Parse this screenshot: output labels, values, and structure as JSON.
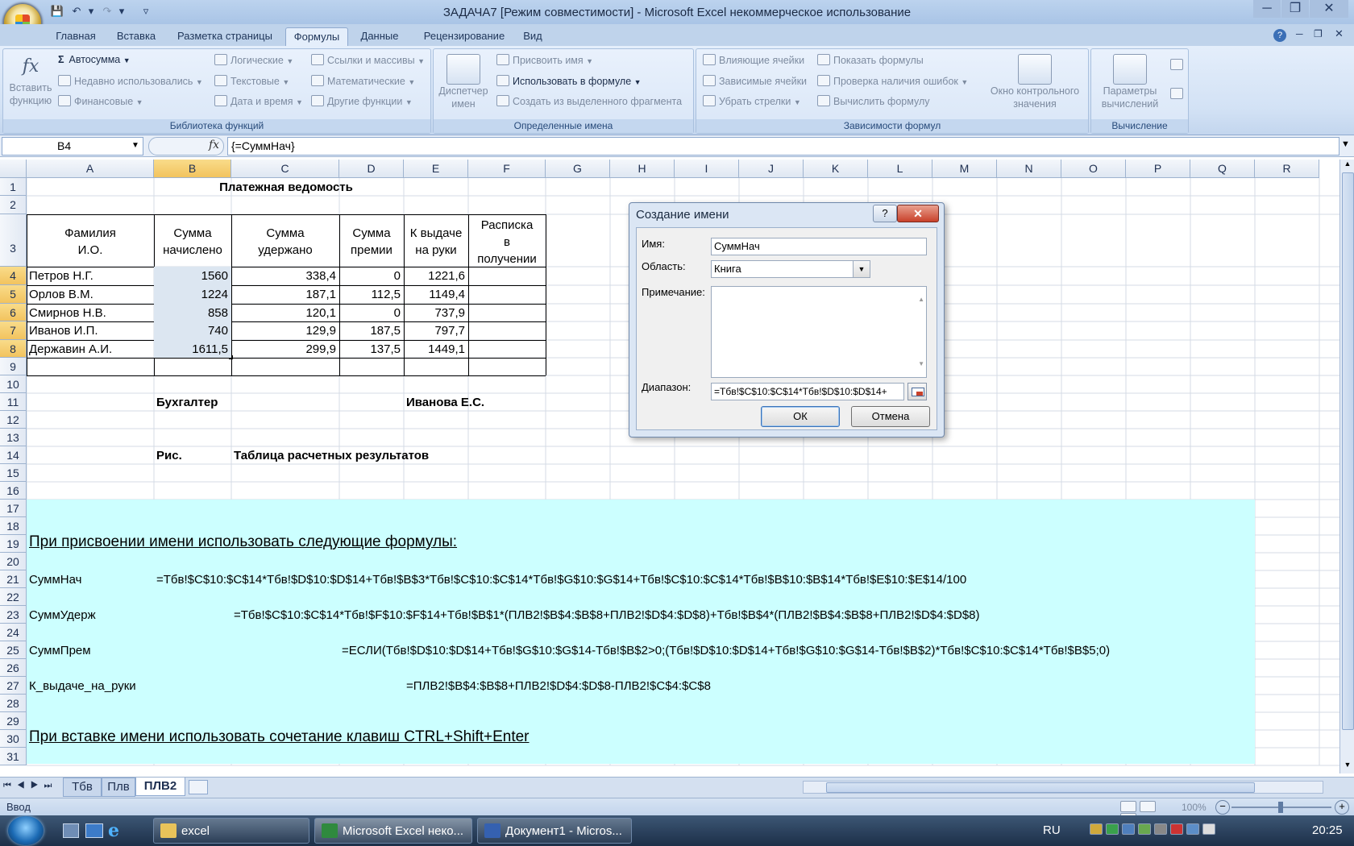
{
  "titlebar": {
    "title": "ЗАДАЧА7  [Режим совместимости] - Microsoft Excel некоммерческое использование"
  },
  "tabs": [
    "Главная",
    "Вставка",
    "Разметка страницы",
    "Формулы",
    "Данные",
    "Рецензирование",
    "Вид"
  ],
  "ribbon": {
    "insert_function": [
      "Вставить",
      "функцию"
    ],
    "lib": {
      "autosum": "Автосумма",
      "recent": "Недавно использовались",
      "financial": "Финансовые",
      "logical": "Логические",
      "text": "Текстовые",
      "datetime": "Дата и время",
      "lookup": "Ссылки и массивы",
      "math": "Математические",
      "other": "Другие функции",
      "label": "Библиотека функций"
    },
    "names": {
      "manager": [
        "Диспетчер",
        "имен"
      ],
      "define": "Присвоить имя",
      "use": "Использовать в формуле",
      "create": "Создать из выделенного фрагмента",
      "label": "Определенные имена"
    },
    "audit": {
      "precedents": "Влияющие ячейки",
      "dependents": "Зависимые ячейки",
      "remove": "Убрать стрелки",
      "show": "Показать формулы",
      "check": "Проверка наличия ошибок",
      "evaluate": "Вычислить формулу",
      "watch": [
        "Окно контрольного",
        "значения"
      ],
      "label": "Зависимости формул"
    },
    "calc": {
      "options": [
        "Параметры",
        "вычислений"
      ],
      "label": "Вычисление"
    }
  },
  "formula_bar": {
    "cell_ref": "B4",
    "fx": "fx",
    "formula": "{=СуммНач}"
  },
  "columns": [
    "A",
    "B",
    "C",
    "D",
    "E",
    "F",
    "G",
    "H",
    "I",
    "J",
    "K",
    "L",
    "M",
    "N",
    "O",
    "P",
    "Q",
    "R"
  ],
  "rows": [
    "1",
    "2",
    "3",
    "4",
    "5",
    "6",
    "7",
    "8",
    "9",
    "10",
    "11",
    "12",
    "13",
    "14",
    "15",
    "16",
    "17",
    "18",
    "19",
    "20",
    "21",
    "22",
    "23",
    "24",
    "25",
    "26",
    "27",
    "28",
    "29",
    "30",
    "31"
  ],
  "sheet": {
    "title": "Платежная ведомость",
    "headers": {
      "a": [
        "Фамилия",
        "И.О."
      ],
      "b": [
        "Сумма",
        "начислено"
      ],
      "c": [
        "Сумма",
        "удержано"
      ],
      "d": [
        "Сумма",
        "премии"
      ],
      "e": [
        "К выдаче",
        "на руки"
      ],
      "f": [
        "Расписка",
        "в",
        "получении"
      ]
    },
    "data": [
      [
        "Петров Н.Г.",
        "1560",
        "338,4",
        "0",
        "1221,6"
      ],
      [
        "Орлов В.М.",
        "1224",
        "187,1",
        "112,5",
        "1149,4"
      ],
      [
        "Смирнов Н.В.",
        "858",
        "120,1",
        "0",
        "737,9"
      ],
      [
        "Иванов И.П.",
        "740",
        "129,9",
        "187,5",
        "797,7"
      ],
      [
        "Державин А.И.",
        "1611,5",
        "299,9",
        "137,5",
        "1449,1"
      ]
    ],
    "accountant_label": "Бухгалтер",
    "accountant_name": "Иванова Е.С.",
    "fig_label": "Рис.",
    "fig_caption": "Таблица расчетных результатов",
    "note1": "При присвоении имени использовать следующие формулы:",
    "names": [
      {
        "name": "СуммНач",
        "formula": "=Тбв!$C$10:$C$14*Тбв!$D$10:$D$14+Тбв!$B$3*Тбв!$C$10:$C$14*Тбв!$G$10:$G$14+Тбв!$C$10:$C$14*Тбв!$B$10:$B$14*Тбв!$E$10:$E$14/100"
      },
      {
        "name": "СуммУдерж",
        "formula": "=Тбв!$C$10:$C$14*Тбв!$F$10:$F$14+Тбв!$B$1*(ПЛВ2!$B$4:$B$8+ПЛВ2!$D$4:$D$8)+Тбв!$B$4*(ПЛВ2!$B$4:$B$8+ПЛВ2!$D$4:$D$8)"
      },
      {
        "name": "СуммПрем",
        "formula": "=ЕСЛИ(Тбв!$D$10:$D$14+Тбв!$G$10:$G$14-Тбв!$B$2>0;(Тбв!$D$10:$D$14+Тбв!$G$10:$G$14-Тбв!$B$2)*Тбв!$C$10:$C$14*Тбв!$B$5;0)"
      },
      {
        "name": "К_выдаче_на_руки",
        "formula": "=ПЛВ2!$B$4:$B$8+ПЛВ2!$D$4:$D$8-ПЛВ2!$C$4:$C$8"
      }
    ],
    "note2": "При вставке имени использовать сочетание клавиш CTRL+Shift+Enter"
  },
  "dialog": {
    "title": "Создание имени",
    "help": "?",
    "name_label": "Имя:",
    "name_value": "СуммНач",
    "scope_label": "Область:",
    "scope_value": "Книга",
    "comment_label": "Примечание:",
    "range_label": "Диапазон:",
    "range_value": "=Тбв!$C$10:$C$14*Тбв!$D$10:$D$14+",
    "ok": "ОК",
    "cancel": "Отмена"
  },
  "sheet_tabs": [
    "Тбв",
    "Плв",
    "ПЛВ2"
  ],
  "status": {
    "mode": "Ввод",
    "zoom": "100%"
  },
  "taskbar": {
    "items": [
      "excel",
      "Microsoft Excel неко...",
      "Документ1 - Micros..."
    ],
    "lang": "RU",
    "time": "20:25"
  },
  "colors": {
    "highlight": "#ccffff",
    "selection": "#dce6f1",
    "accent": "#2b579a"
  }
}
